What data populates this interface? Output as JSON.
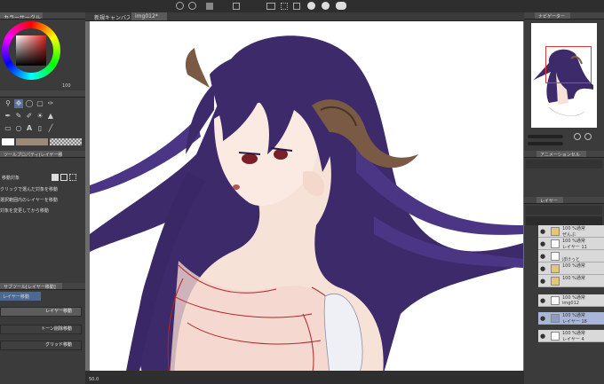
{
  "canvas_tabs": {
    "tab1": "新規キャンバス",
    "tab2": "img012*"
  },
  "panels": {
    "color_wheel_tab": "カラーサークル",
    "color_value": "100",
    "tool_props_tab": "ツールプロパティ(レイヤー移動)",
    "tool_prop_label": "移動対象",
    "tool_prop_rows": [
      "クリックで選んだ対象を移動",
      "選択範囲内のレイヤーを移動",
      "対象を変更してから移動"
    ],
    "sub_tool_tab": "サブツール[レイヤー移動]",
    "sub_tool_header": "レイヤー移動",
    "sub_tools": [
      "レイヤー移動",
      "トーン削除移動",
      "グリッド移動"
    ],
    "navigator_tab": "ナビゲーター",
    "anim_tab": "アニメーションセル",
    "layer_tab": "レイヤー",
    "zoom_value": "50.0"
  },
  "layers": [
    {
      "pct": "100 %通常",
      "name": "ぜんぶ"
    },
    {
      "pct": "100 %通常",
      "name": "レイヤー 11"
    },
    {
      "pct": "",
      "name": "ぼけっと"
    },
    {
      "pct": "100 %通常",
      "name": ""
    },
    {
      "pct": "100 %通常",
      "name": ""
    },
    {
      "pct": "100 %通常",
      "name": "img012"
    },
    {
      "pct": "100 %通常",
      "name": "レイヤー 18"
    },
    {
      "pct": "100 %通常",
      "name": "レイヤー 4"
    }
  ],
  "colors": {
    "ui_bg": "#3b3b3b",
    "canvas_bg": "#ffffff",
    "hair": "#3d2a6b",
    "horn": "#7a5a44",
    "skin": "#f7e2d8",
    "selected_layer": "#a9b7d6"
  }
}
